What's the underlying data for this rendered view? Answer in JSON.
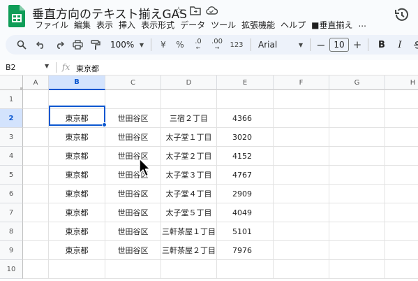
{
  "app": {
    "title": "垂直方向のテキスト揃えGAS",
    "menu": [
      "ファイル",
      "編集",
      "表示",
      "挿入",
      "表示形式",
      "データ",
      "ツール",
      "拡張機能",
      "ヘルプ",
      "■垂直揃え",
      "..."
    ]
  },
  "toolbar": {
    "zoom": "100%",
    "currency": "¥",
    "percent": "%",
    "dec_decrease": ".0",
    "dec_increase": ".00",
    "number_format": "123",
    "font": "Arial",
    "font_size": "10",
    "bold": "B",
    "italic": "I"
  },
  "formula_bar": {
    "name_box": "B2",
    "fx": "fx",
    "content": "東京都"
  },
  "sheet": {
    "columns": [
      "A",
      "B",
      "C",
      "D",
      "E",
      "F",
      "G",
      "H"
    ],
    "selected_column": "B",
    "selected_row": "2",
    "rows": [
      {
        "num": "1",
        "cells": [
          "",
          "",
          "",
          "",
          ""
        ]
      },
      {
        "num": "2",
        "cells": [
          "",
          "東京都",
          "世田谷区",
          "三宿２丁目",
          "4366"
        ]
      },
      {
        "num": "3",
        "cells": [
          "",
          "東京都",
          "世田谷区",
          "太子堂１丁目",
          "3020"
        ]
      },
      {
        "num": "4",
        "cells": [
          "",
          "東京都",
          "世田谷区",
          "太子堂２丁目",
          "4152"
        ]
      },
      {
        "num": "5",
        "cells": [
          "",
          "東京都",
          "世田谷区",
          "太子堂３丁目",
          "4767"
        ]
      },
      {
        "num": "6",
        "cells": [
          "",
          "東京都",
          "世田谷区",
          "太子堂４丁目",
          "2909"
        ]
      },
      {
        "num": "7",
        "cells": [
          "",
          "東京都",
          "世田谷区",
          "太子堂５丁目",
          "4049"
        ]
      },
      {
        "num": "8",
        "cells": [
          "",
          "東京都",
          "世田谷区",
          "三軒茶屋１丁目",
          "5101"
        ]
      },
      {
        "num": "9",
        "cells": [
          "",
          "東京都",
          "世田谷区",
          "三軒茶屋２丁目",
          "7976"
        ]
      },
      {
        "num": "10",
        "cells": [
          "",
          "",
          "",
          "",
          ""
        ]
      }
    ]
  },
  "colors": {
    "accent": "#0b57d0",
    "selected_header": "#d3e3fd",
    "sheets_green": "#0f9d58"
  }
}
